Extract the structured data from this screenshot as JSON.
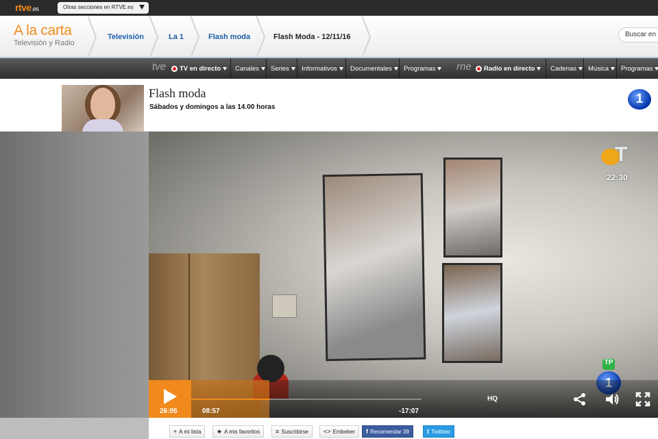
{
  "topbar": {
    "logo_main": "rtve",
    "logo_suffix": ".es",
    "sections_select": "Otras secciones en RTVE.es"
  },
  "header": {
    "brand_title": "A la carta",
    "brand_subtitle": "Televisión y Radio",
    "breadcrumb": [
      "Televisión",
      "La 1",
      "Flash moda",
      "Flash Moda - 12/11/16"
    ],
    "search_placeholder": "Buscar en"
  },
  "nav": {
    "tve_logo": "tve",
    "tv_live": "TV en directo",
    "tv_items": [
      "Canales",
      "Series",
      "Informativos",
      "Documentales",
      "Programas"
    ],
    "rne_logo": "rne",
    "radio_live": "Radio en directo",
    "radio_items": [
      "Cadenas",
      "Música",
      "Programas"
    ]
  },
  "program": {
    "title": "Flash moda",
    "schedule": "Sábados y domingos a las 14.00 horas",
    "channel_badge": "1"
  },
  "video": {
    "channel_time": "22:30",
    "channel_logo_letter": "T",
    "tp_badge": "TP",
    "la1_badge": "1"
  },
  "player": {
    "total_time": "26:05",
    "current_time": "08:57",
    "remaining_time": "-17:07",
    "progress_fraction": 0.343,
    "hq_label": "HQ"
  },
  "actions": [
    {
      "icon": "+",
      "label": "A mi lista"
    },
    {
      "icon": "★",
      "label": "A mis favoritos"
    },
    {
      "icon": "≡",
      "label": "Suscribirse"
    },
    {
      "icon": "<>",
      "label": "Embeber"
    },
    {
      "icon": "f",
      "label": "Recomendar 39"
    },
    {
      "icon": "t",
      "label": "Twittear"
    }
  ],
  "colors": {
    "accent_orange": "#f08a1c",
    "link_blue": "#1a5ea8",
    "facebook": "#3b5c9e",
    "twitter": "#2a9ce4"
  }
}
